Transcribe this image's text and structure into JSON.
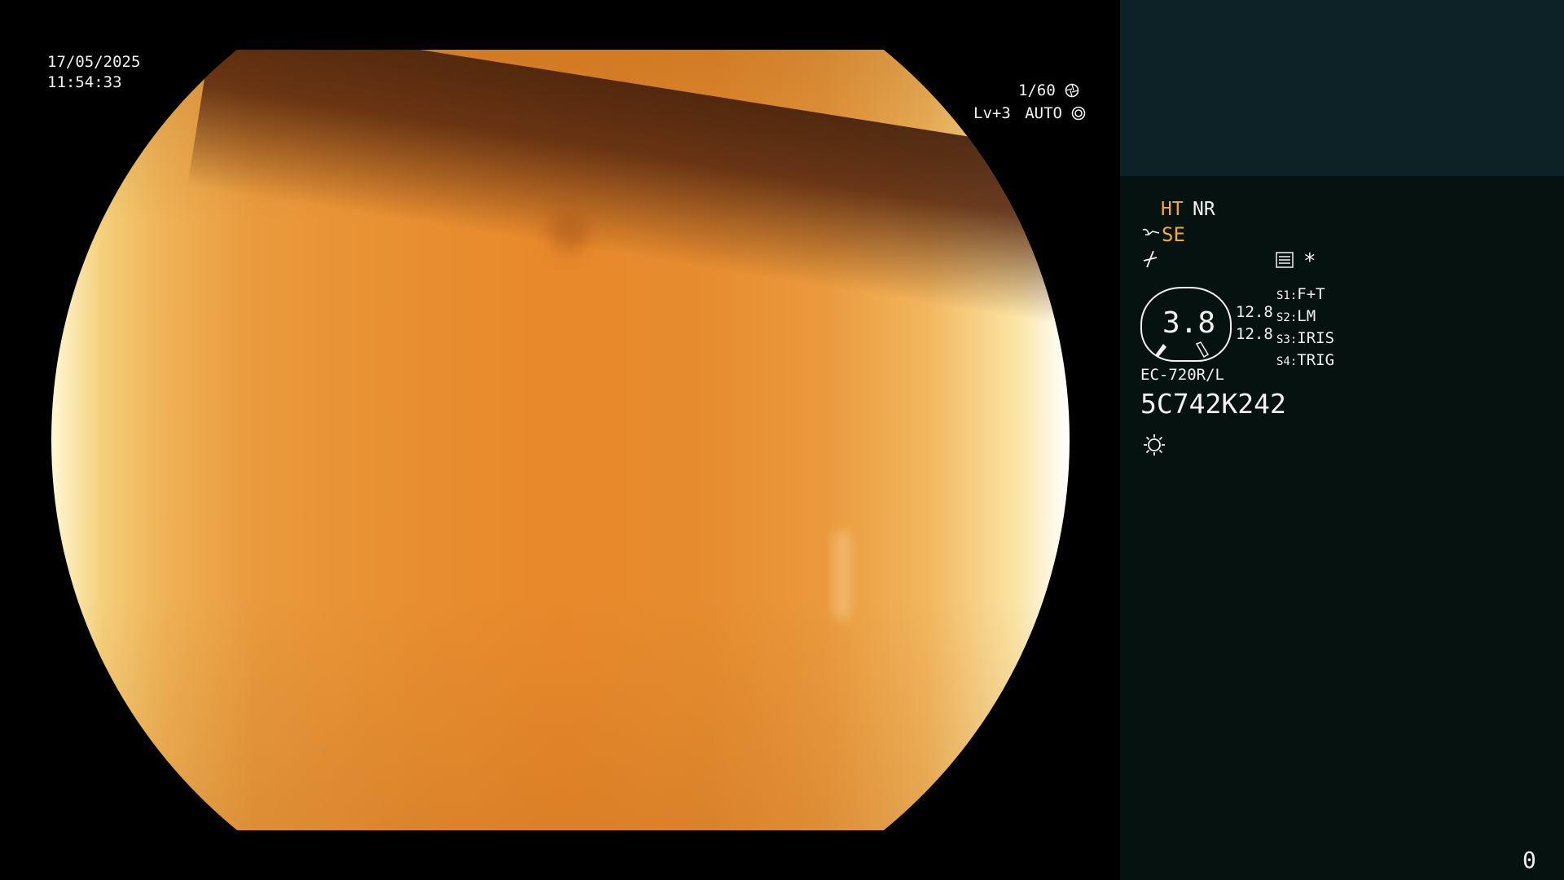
{
  "overlay": {
    "date": "17/05/2025",
    "time": "11:54:33",
    "shutter": "1/60",
    "shutter_icon": "aperture-icon",
    "level": "Lv+3",
    "mode": "AUTO",
    "mode_icon": "auto-iris-icon"
  },
  "sidebar": {
    "ht": "HT",
    "nr": "NR",
    "se": "SE",
    "se_icon": "enhance-icon",
    "enhance_icon": "signal-icon",
    "settings_icon": "menu-icon",
    "asterisk": "*",
    "zoom_value": "3.8",
    "zoom_top": "12.8",
    "zoom_bottom": "12.8",
    "switches": [
      {
        "key": "S1:",
        "value": "F+T"
      },
      {
        "key": "S2:",
        "value": "LM"
      },
      {
        "key": "S3:",
        "value": "IRIS"
      },
      {
        "key": "S4:",
        "value": "TRIG"
      }
    ],
    "scope_model": "EC-720R/L",
    "scope_serial": "5C742K242",
    "light_icon": "light-source-icon",
    "counter": "0"
  },
  "colors": {
    "accent_amber": "#f2ad2c",
    "sidebar_bg": "#06120f",
    "sidebar_header_bg": "#0d2226",
    "text": "#f2f2f2"
  }
}
